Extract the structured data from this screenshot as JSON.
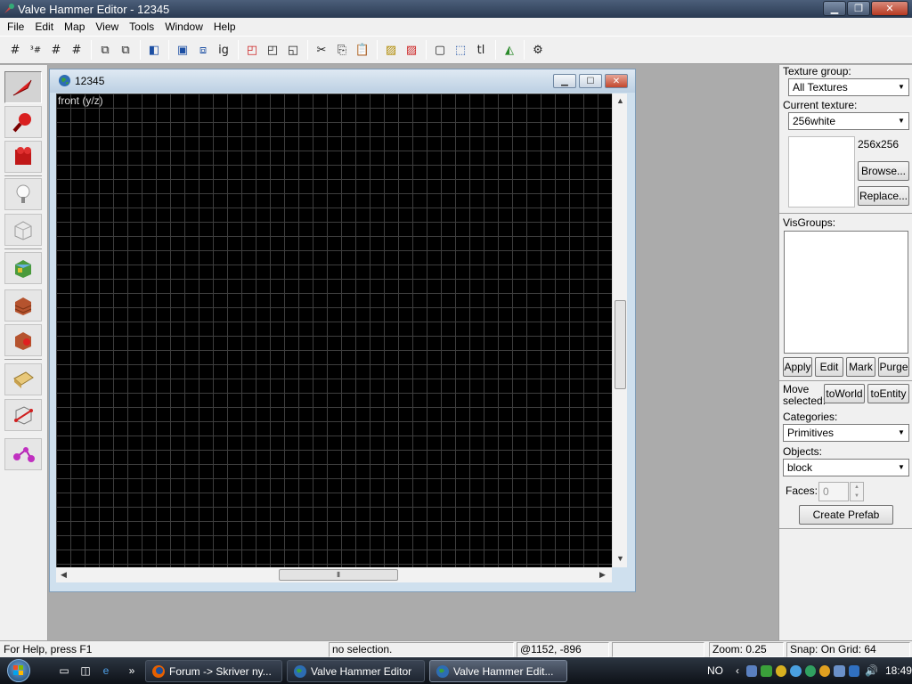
{
  "window": {
    "title": "Valve Hammer Editor - 12345"
  },
  "menubar": [
    "File",
    "Edit",
    "Map",
    "View",
    "Tools",
    "Window",
    "Help"
  ],
  "toolbar": {
    "icons": [
      "grid-toggle-icon",
      "grid-3d-icon",
      "grid-smaller-icon",
      "grid-larger-icon",
      "carve-icon",
      "hollow-icon",
      "group-icon",
      "ungroup-icon",
      "texture-lock-icon",
      "hide-icon",
      "cut-icon",
      "copy-icon",
      "paste-icon",
      "hazard-icon",
      "hazard-alt-icon",
      "clip-icon",
      "select-icon",
      "text-tool-icon",
      "compile-icon",
      "options-icon"
    ],
    "text_glyphs": {
      "ig": "ig",
      "tl": "tl"
    }
  },
  "left_tools": [
    "selection-tool-icon",
    "magnify-tool-icon",
    "camera-tool-icon",
    "entity-tool-icon",
    "block-tool-icon",
    "texture-application-icon",
    "apply-texture-icon",
    "decal-tool-icon",
    "overlay-tool-icon",
    "clipping-tool-icon",
    "vertex-tool-icon"
  ],
  "child_window": {
    "title": "12345",
    "view_label": "front (y/z)"
  },
  "right_panel": {
    "texture_group_label": "Texture group:",
    "texture_group_value": "All Textures",
    "current_texture_label": "Current texture:",
    "current_texture_value": "256white",
    "texture_size": "256x256",
    "browse_label": "Browse...",
    "replace_label": "Replace...",
    "visgroups_label": "VisGroups:",
    "apply_label": "Apply",
    "edit_label": "Edit",
    "mark_label": "Mark",
    "purge_label": "Purge",
    "move_selected_label_1": "Move",
    "move_selected_label_2": "selected:",
    "toworld_label": "toWorld",
    "toentity_label": "toEntity",
    "categories_label": "Categories:",
    "categories_value": "Primitives",
    "objects_label": "Objects:",
    "objects_value": "block",
    "faces_label": "Faces:",
    "faces_value": "0",
    "create_prefab_label": "Create Prefab"
  },
  "status": {
    "help": "For Help, press F1",
    "selection": "no selection.",
    "coords": "@1152, -896",
    "zoom": "Zoom: 0.25",
    "snap": "Snap: On Grid: 64"
  },
  "taskbar": {
    "tasks": [
      "Forum -> Skriver ny...",
      "Valve Hammer Editor",
      "Valve Hammer Edit..."
    ],
    "language": "NO",
    "clock": "18:49",
    "chevron": "»"
  },
  "colors": {
    "viewport_bg": "#000000",
    "grid_line": "#3e3e3e",
    "title_bar": "#2a3a52"
  }
}
